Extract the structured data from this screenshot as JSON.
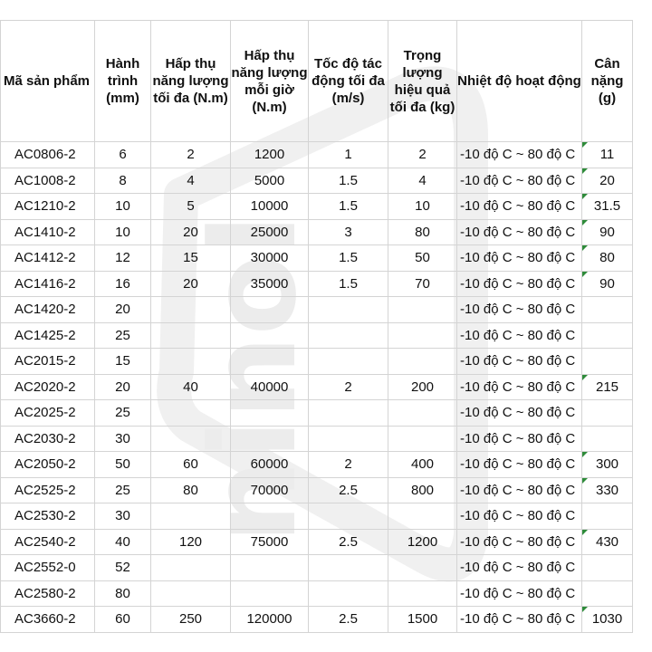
{
  "headers": [
    "Mã sản phẩm",
    "Hành trình (mm)",
    "Hấp thụ năng lượng tối đa (N.m)",
    "Hấp thụ năng lượng mỗi giờ (N.m)",
    "Tốc độ tác động tối đa (m/s)",
    "Trọng lượng hiệu quả tối đa (kg)",
    "Nhiệt độ hoạt động",
    "Cân nặng (g)"
  ],
  "rows": [
    {
      "code": "AC0806-2",
      "stroke": "6",
      "max_energy": "2",
      "hourly_energy": "1200",
      "speed": "1",
      "mass": "2",
      "temp": "-10 độ C ~ 80 độ C",
      "weight": "11"
    },
    {
      "code": "AC1008-2",
      "stroke": "8",
      "max_energy": "4",
      "hourly_energy": "5000",
      "speed": "1.5",
      "mass": "4",
      "temp": "-10 độ C ~ 80 độ C",
      "weight": "20"
    },
    {
      "code": "AC1210-2",
      "stroke": "10",
      "max_energy": "5",
      "hourly_energy": "10000",
      "speed": "1.5",
      "mass": "10",
      "temp": "-10 độ C ~ 80 độ C",
      "weight": "31.5"
    },
    {
      "code": "AC1410-2",
      "stroke": "10",
      "max_energy": "20",
      "hourly_energy": "25000",
      "speed": "3",
      "mass": "80",
      "temp": "-10 độ C ~ 80 độ C",
      "weight": "90"
    },
    {
      "code": "AC1412-2",
      "stroke": "12",
      "max_energy": "15",
      "hourly_energy": "30000",
      "speed": "1.5",
      "mass": "50",
      "temp": "-10 độ C ~ 80 độ C",
      "weight": "80"
    },
    {
      "code": "AC1416-2",
      "stroke": "16",
      "max_energy": "20",
      "hourly_energy": "35000",
      "speed": "1.5",
      "mass": "70",
      "temp": "-10 độ C ~ 80 độ C",
      "weight": "90"
    },
    {
      "code": "AC1420-2",
      "stroke": "20",
      "max_energy": "",
      "hourly_energy": "",
      "speed": "",
      "mass": "",
      "temp": "-10 độ C ~ 80 độ C",
      "weight": ""
    },
    {
      "code": "AC1425-2",
      "stroke": "25",
      "max_energy": "",
      "hourly_energy": "",
      "speed": "",
      "mass": "",
      "temp": "-10 độ C ~ 80 độ C",
      "weight": ""
    },
    {
      "code": "AC2015-2",
      "stroke": "15",
      "max_energy": "",
      "hourly_energy": "",
      "speed": "",
      "mass": "",
      "temp": "-10 độ C ~ 80 độ C",
      "weight": ""
    },
    {
      "code": "AC2020-2",
      "stroke": "20",
      "max_energy": "40",
      "hourly_energy": "40000",
      "speed": "2",
      "mass": "200",
      "temp": "-10 độ C ~ 80 độ C",
      "weight": "215"
    },
    {
      "code": "AC2025-2",
      "stroke": "25",
      "max_energy": "",
      "hourly_energy": "",
      "speed": "",
      "mass": "",
      "temp": "-10 độ C ~ 80 độ C",
      "weight": ""
    },
    {
      "code": "AC2030-2",
      "stroke": "30",
      "max_energy": "",
      "hourly_energy": "",
      "speed": "",
      "mass": "",
      "temp": "-10 độ C ~ 80 độ C",
      "weight": ""
    },
    {
      "code": "AC2050-2",
      "stroke": "50",
      "max_energy": "60",
      "hourly_energy": "60000",
      "speed": "2",
      "mass": "400",
      "temp": "-10 độ C ~ 80 độ C",
      "weight": "300"
    },
    {
      "code": "AC2525-2",
      "stroke": "25",
      "max_energy": "80",
      "hourly_energy": "70000",
      "speed": "2.5",
      "mass": "800",
      "temp": "-10 độ C ~ 80 độ C",
      "weight": "330"
    },
    {
      "code": "AC2530-2",
      "stroke": "30",
      "max_energy": "",
      "hourly_energy": "",
      "speed": "",
      "mass": "",
      "temp": "-10 độ C ~ 80 độ C",
      "weight": ""
    },
    {
      "code": "AC2540-2",
      "stroke": "40",
      "max_energy": "120",
      "hourly_energy": "75000",
      "speed": "2.5",
      "mass": "1200",
      "temp": "-10 độ C ~ 80 độ C",
      "weight": "430"
    },
    {
      "code": "AC2552-0",
      "stroke": "52",
      "max_energy": "",
      "hourly_energy": "",
      "speed": "",
      "mass": "",
      "temp": "-10 độ C ~ 80 độ C",
      "weight": ""
    },
    {
      "code": "AC2580-2",
      "stroke": "80",
      "max_energy": "",
      "hourly_energy": "",
      "speed": "",
      "mass": "",
      "temp": "-10 độ C ~ 80 độ C",
      "weight": ""
    },
    {
      "code": "AC3660-2",
      "stroke": "60",
      "max_energy": "250",
      "hourly_energy": "120000",
      "speed": "2.5",
      "mass": "1500",
      "temp": "-10 độ C ~ 80 độ C",
      "weight": "1030"
    }
  ],
  "watermark": {
    "text": "ninol",
    "color": "#ececec"
  },
  "colors": {
    "comment_flag": "#2e8b3a",
    "grid": "#d4d4d4"
  }
}
